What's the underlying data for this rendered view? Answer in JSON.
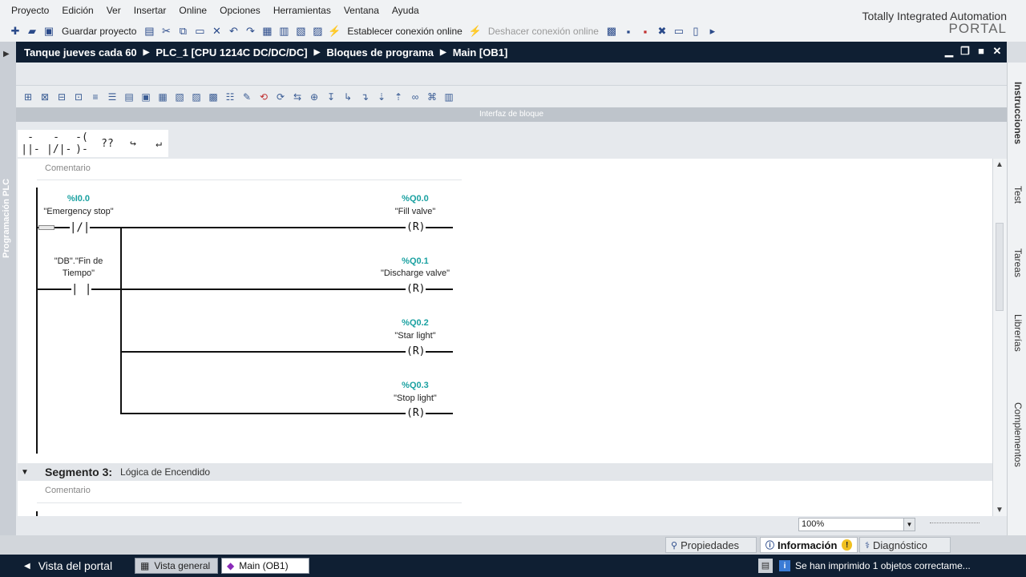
{
  "menu": [
    "Proyecto",
    "Edición",
    "Ver",
    "Insertar",
    "Online",
    "Opciones",
    "Herramientas",
    "Ventana",
    "Ayuda"
  ],
  "brand": {
    "line1": "Totally Integrated Automation",
    "line2": "PORTAL"
  },
  "toolbar": {
    "save_label": "Guardar proyecto",
    "go_online_label": "Establecer conexión online",
    "go_offline_label": "Deshacer conexión online"
  },
  "breadcrumb": [
    "Tanque jueves cada 60",
    "PLC_1 [CPU 1214C DC/DC/DC]",
    "Bloques de programa",
    "Main [OB1]"
  ],
  "left_strip_label": "Programación PLC",
  "interface_bar_label": "Interfaz de bloque",
  "palette": [
    "-||-",
    "-|/|-",
    "-( )-",
    "??",
    "↪",
    "↵"
  ],
  "network2": {
    "comment": "Comentario",
    "contacts": [
      {
        "address": "%I0.0",
        "tag": "\"Emergency stop\"",
        "type": "NC"
      },
      {
        "address": "",
        "tag_line1": "\"DB\".\"Fin de",
        "tag_line2": "Tiempo\"",
        "type": "NO"
      }
    ],
    "coils": [
      {
        "address": "%Q0.0",
        "tag": "\"Fill valve\"",
        "op": "R"
      },
      {
        "address": "%Q0.1",
        "tag": "\"Discharge valve\"",
        "op": "R"
      },
      {
        "address": "%Q0.2",
        "tag": "\"Star light\"",
        "op": "R"
      },
      {
        "address": "%Q0.3",
        "tag": "\"Stop light\"",
        "op": "R"
      }
    ]
  },
  "segment3": {
    "title": "Segmento 3:",
    "description": "Lógica de Encendido",
    "comment": "Comentario"
  },
  "zoom": "100%",
  "right_tabs": [
    "Instrucciones",
    "Test",
    "Tareas",
    "Librerías",
    "Complementos"
  ],
  "inspector_tabs": {
    "properties": "Propiedades",
    "info": "Información",
    "diagnostics": "Diagnóstico"
  },
  "statusbar": {
    "portal_view": "Vista del portal",
    "overview": "Vista general",
    "main_tab": "Main (OB1)",
    "message": "Se han imprimido 1 objetos correctame..."
  }
}
